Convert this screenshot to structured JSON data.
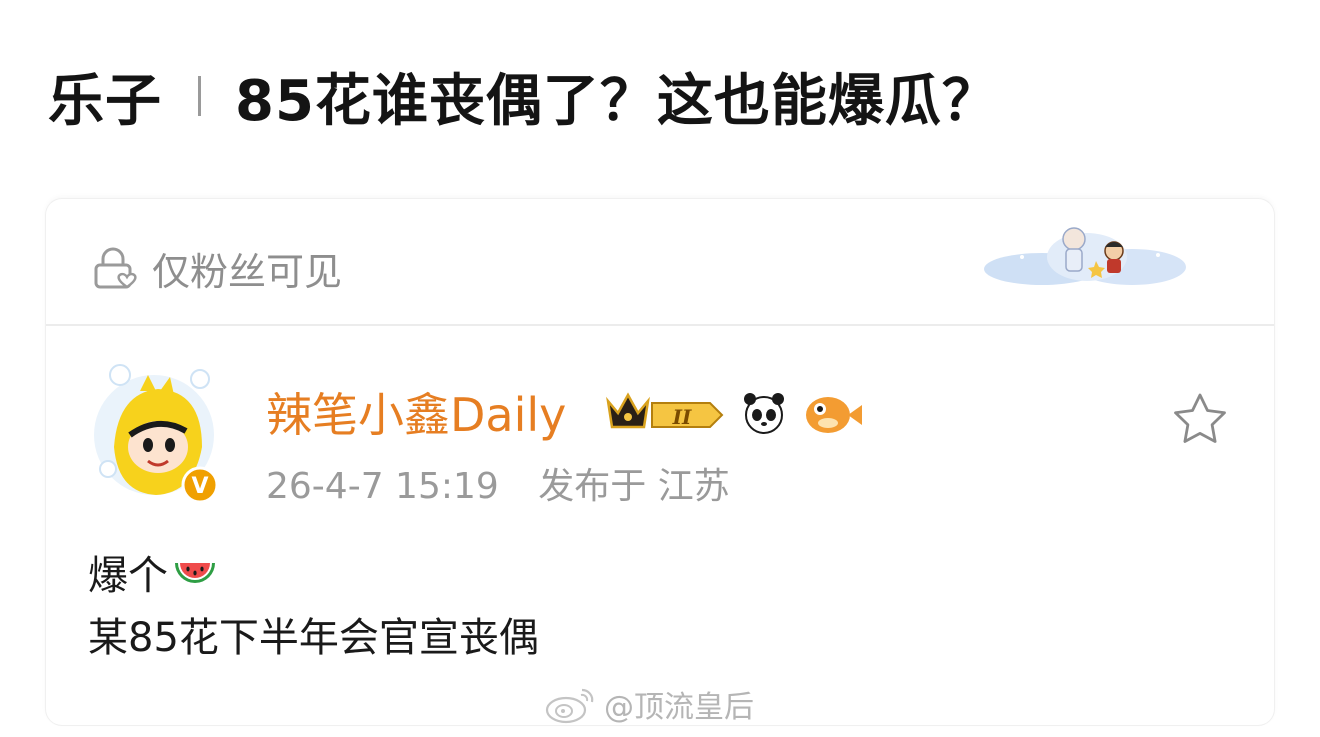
{
  "headline": {
    "category": "乐子",
    "title": "85花谁丧偶了？这也能爆瓜？"
  },
  "card": {
    "visibility_icon": "lock-heart-icon",
    "visibility_label": "仅粉丝可见",
    "author": {
      "name": "辣笔小鑫Daily",
      "verified_badge": "V",
      "level_badge": "II",
      "timestamp": "26-4-7 15:19",
      "location_prefix": "发布于",
      "location": "江苏"
    },
    "post": {
      "line1": "爆个",
      "line1_emoji": "watermelon-icon",
      "line2": "某85花下半年会官宣丧偶"
    }
  },
  "watermark": {
    "text": "@顶流皇后",
    "icon": "weibo-logo-icon"
  },
  "colors": {
    "username": "#e67e22",
    "muted_text": "#9a9a9a",
    "verified": "#f0a000"
  }
}
